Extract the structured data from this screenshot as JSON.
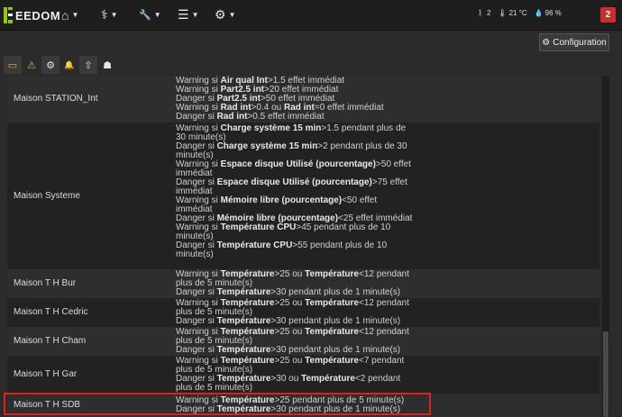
{
  "header": {
    "logo_text": "EEDOM",
    "nav": [
      {
        "name": "home",
        "icon": "home-icon",
        "glyph": "⌂"
      },
      {
        "name": "health",
        "icon": "stethoscope-icon",
        "glyph": "⚕"
      },
      {
        "name": "tools",
        "icon": "wrench-icon",
        "glyph": "🔧"
      },
      {
        "name": "list",
        "icon": "list-icon",
        "glyph": "☰"
      },
      {
        "name": "settings",
        "icon": "gear-icon",
        "glyph": "⚙"
      }
    ],
    "info": {
      "persons": "2",
      "temperature": "21 °C",
      "humidity": "96 %"
    },
    "badge": "2"
  },
  "config_button": "Configuration",
  "toolbar": [
    {
      "icon": "battery-icon",
      "glyph": "▭",
      "color": "#f0ad4e"
    },
    {
      "icon": "warning-icon",
      "glyph": "⚠",
      "color": "#f0ad4e"
    },
    {
      "icon": "cogs-icon",
      "glyph": "⚙",
      "color": "#e5e5e5"
    },
    {
      "icon": "bell-icon",
      "glyph": "🔔",
      "color": "#e5e5e5"
    },
    {
      "icon": "upload-icon",
      "glyph": "⇧",
      "color": "#e5e5e5"
    },
    {
      "icon": "ghost-icon",
      "glyph": "☗",
      "color": "#e5e5e5"
    }
  ],
  "rows": [
    {
      "name": "Maison STATION_Int",
      "lines": [
        [
          "Warning si ",
          "**Air qual Int",
          ">1.5 effet immédiat"
        ],
        [
          "Warning si ",
          "**Part2.5 int",
          ">20 effet immédiat"
        ],
        [
          "Danger si ",
          "**Part2.5 int",
          ">50 effet immédiat"
        ],
        [
          "Warning si ",
          "**Rad int",
          ">0.4 ou ",
          "**Rad int",
          "=0 effet immédiat"
        ],
        [
          "Danger si ",
          "**Rad int",
          ">0.5 effet immédiat"
        ]
      ]
    },
    {
      "name": "Maison Systeme",
      "lines": [
        [
          "Warning si ",
          "**Charge système 15 min",
          ">1.5 pendant plus de 30 minute(s)"
        ],
        [
          "Danger si ",
          "**Charge système 15 min",
          ">2 pendant plus de 30 minute(s)"
        ],
        [
          "Warning si ",
          "**Espace disque Utilisé (pourcentage)",
          ">50 effet immédiat"
        ],
        [
          "Danger si ",
          "**Espace disque Utilisé (pourcentage)",
          ">75 effet immédiat"
        ],
        [
          "Warning si ",
          "**Mémoire libre (pourcentage)",
          "<50 effet immédiat"
        ],
        [
          "Danger si ",
          "**Mémoire libre (pourcentage)",
          "<25 effet immédiat"
        ],
        [
          "Warning si ",
          "**Température CPU",
          ">45 pendant plus de 10 minute(s)"
        ],
        [
          "Danger si ",
          "**Température CPU",
          ">55 pendant plus de 10 minute(s)"
        ]
      ]
    },
    {
      "name": "Maison T H Bur",
      "lines": [
        [
          "Warning si ",
          "**Température",
          ">25 ou ",
          "**Température",
          "<12 pendant plus de 5 minute(s)"
        ],
        [
          "Danger si ",
          "**Température",
          ">30 pendant plus de 1 minute(s)"
        ]
      ]
    },
    {
      "name": "Maison T H Cedric",
      "lines": [
        [
          "Warning si ",
          "**Température",
          ">25 ou ",
          "**Température",
          "<12 pendant plus de 5 minute(s)"
        ],
        [
          "Danger si ",
          "**Température",
          ">30 pendant plus de 1 minute(s)"
        ]
      ]
    },
    {
      "name": "Maison T H Cham",
      "lines": [
        [
          "Warning si ",
          "**Température",
          ">25 ou ",
          "**Température",
          "<12 pendant plus de 5 minute(s)"
        ],
        [
          "Danger si ",
          "**Température",
          ">30 pendant plus de 1 minute(s)"
        ]
      ]
    },
    {
      "name": "Maison T H Gar",
      "lines": [
        [
          "Warning si ",
          "**Température",
          ">25 ou ",
          "**Température",
          "<7 pendant plus de 5 minute(s)"
        ],
        [
          "Danger si ",
          "**Température",
          ">30 ou ",
          "**Température",
          "<2 pendant plus de 5 minute(s)"
        ]
      ]
    },
    {
      "name": "Maison T H SDB",
      "lines": [
        [
          "Warning si ",
          "**Température",
          ">25 pendant plus de 5 minute(s)"
        ],
        [
          "Danger si ",
          "**Température",
          ">30 pendant plus de 1 minute(s)"
        ]
      ]
    }
  ]
}
